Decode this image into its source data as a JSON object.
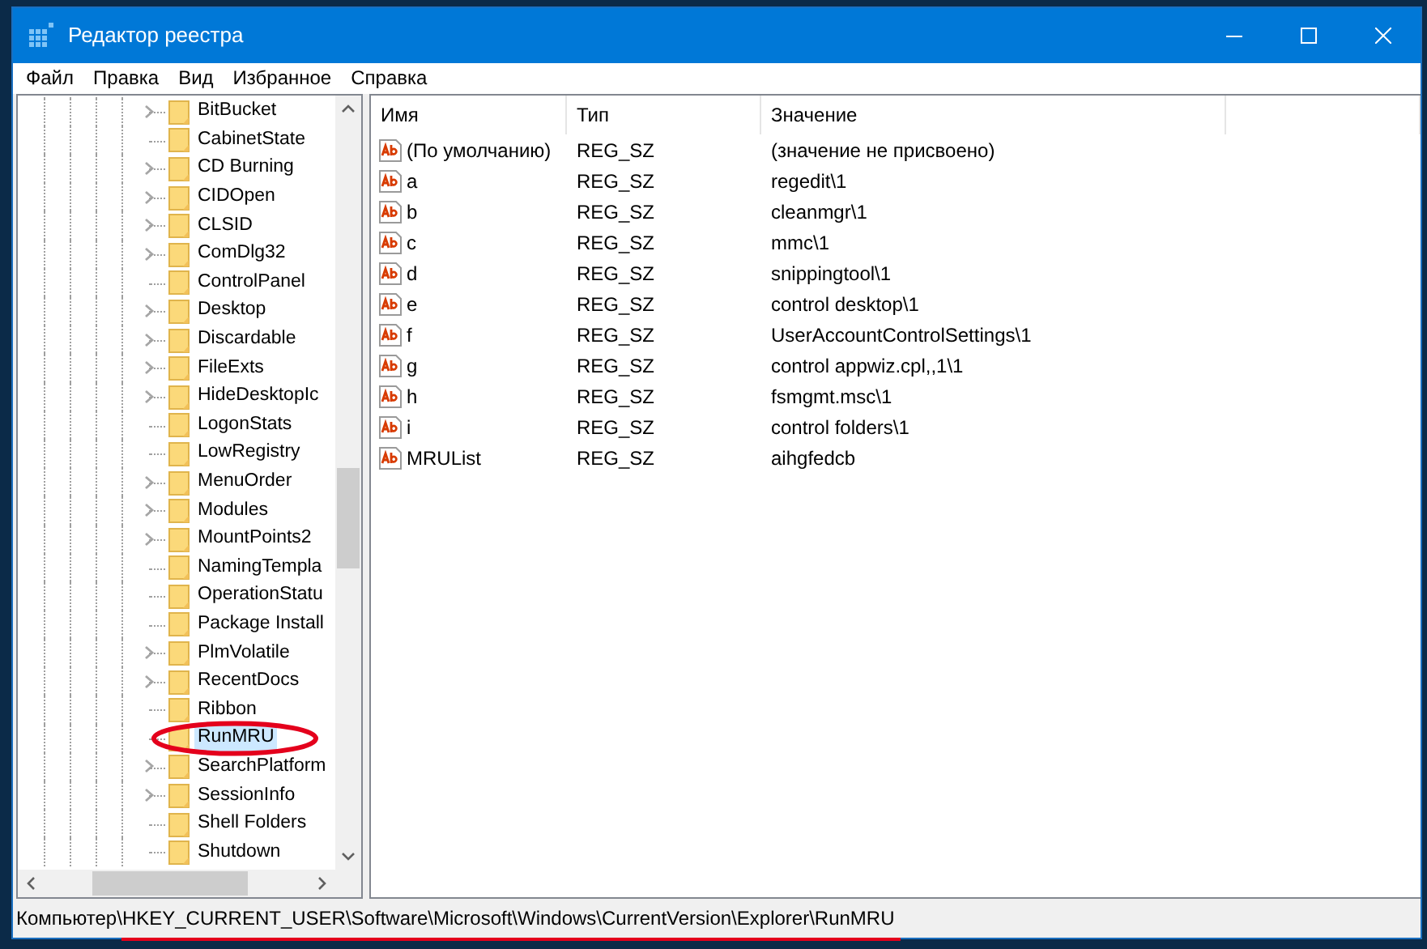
{
  "window": {
    "title": "Редактор реестра"
  },
  "menu": [
    "Файл",
    "Правка",
    "Вид",
    "Избранное",
    "Справка"
  ],
  "tree": {
    "items": [
      {
        "label": "BitBucket",
        "expandable": true,
        "selected": false
      },
      {
        "label": "CabinetState",
        "expandable": false,
        "selected": false
      },
      {
        "label": "CD Burning",
        "expandable": true,
        "selected": false
      },
      {
        "label": "CIDOpen",
        "expandable": true,
        "selected": false
      },
      {
        "label": "CLSID",
        "expandable": true,
        "selected": false
      },
      {
        "label": "ComDlg32",
        "expandable": true,
        "selected": false
      },
      {
        "label": "ControlPanel",
        "expandable": false,
        "selected": false
      },
      {
        "label": "Desktop",
        "expandable": true,
        "selected": false
      },
      {
        "label": "Discardable",
        "expandable": true,
        "selected": false
      },
      {
        "label": "FileExts",
        "expandable": true,
        "selected": false
      },
      {
        "label": "HideDesktopIc",
        "expandable": true,
        "selected": false
      },
      {
        "label": "LogonStats",
        "expandable": false,
        "selected": false
      },
      {
        "label": "LowRegistry",
        "expandable": false,
        "selected": false
      },
      {
        "label": "MenuOrder",
        "expandable": true,
        "selected": false
      },
      {
        "label": "Modules",
        "expandable": true,
        "selected": false
      },
      {
        "label": "MountPoints2",
        "expandable": true,
        "selected": false
      },
      {
        "label": "NamingTempla",
        "expandable": false,
        "selected": false
      },
      {
        "label": "OperationStatu",
        "expandable": false,
        "selected": false
      },
      {
        "label": "Package Install",
        "expandable": false,
        "selected": false
      },
      {
        "label": "PlmVolatile",
        "expandable": true,
        "selected": false
      },
      {
        "label": "RecentDocs",
        "expandable": true,
        "selected": false
      },
      {
        "label": "Ribbon",
        "expandable": false,
        "selected": false
      },
      {
        "label": "RunMRU",
        "expandable": false,
        "selected": true,
        "circled": true
      },
      {
        "label": "SearchPlatform",
        "expandable": true,
        "selected": false
      },
      {
        "label": "SessionInfo",
        "expandable": true,
        "selected": false
      },
      {
        "label": "Shell Folders",
        "expandable": false,
        "selected": false
      },
      {
        "label": "Shutdown",
        "expandable": false,
        "selected": false
      }
    ]
  },
  "table": {
    "columns": [
      "Имя",
      "Тип",
      "Значение"
    ],
    "rows": [
      [
        "(По умолчанию)",
        "REG_SZ",
        "(значение не присвоено)"
      ],
      [
        "a",
        "REG_SZ",
        "regedit\\1"
      ],
      [
        "b",
        "REG_SZ",
        "cleanmgr\\1"
      ],
      [
        "c",
        "REG_SZ",
        "mmc\\1"
      ],
      [
        "d",
        "REG_SZ",
        "snippingtool\\1"
      ],
      [
        "e",
        "REG_SZ",
        "control desktop\\1"
      ],
      [
        "f",
        "REG_SZ",
        "UserAccountControlSettings\\1"
      ],
      [
        "g",
        "REG_SZ",
        "control appwiz.cpl,,1\\1"
      ],
      [
        "h",
        "REG_SZ",
        "fsmgmt.msc\\1"
      ],
      [
        "i",
        "REG_SZ",
        "control folders\\1"
      ],
      [
        "MRUList",
        "REG_SZ",
        "aihgfedcb"
      ]
    ]
  },
  "status_bar": {
    "text": "Компьютер\\HKEY_CURRENT_USER\\Software\\Microsoft\\Windows\\CurrentVersion\\Explorer\\RunMRU",
    "underlined": true
  }
}
